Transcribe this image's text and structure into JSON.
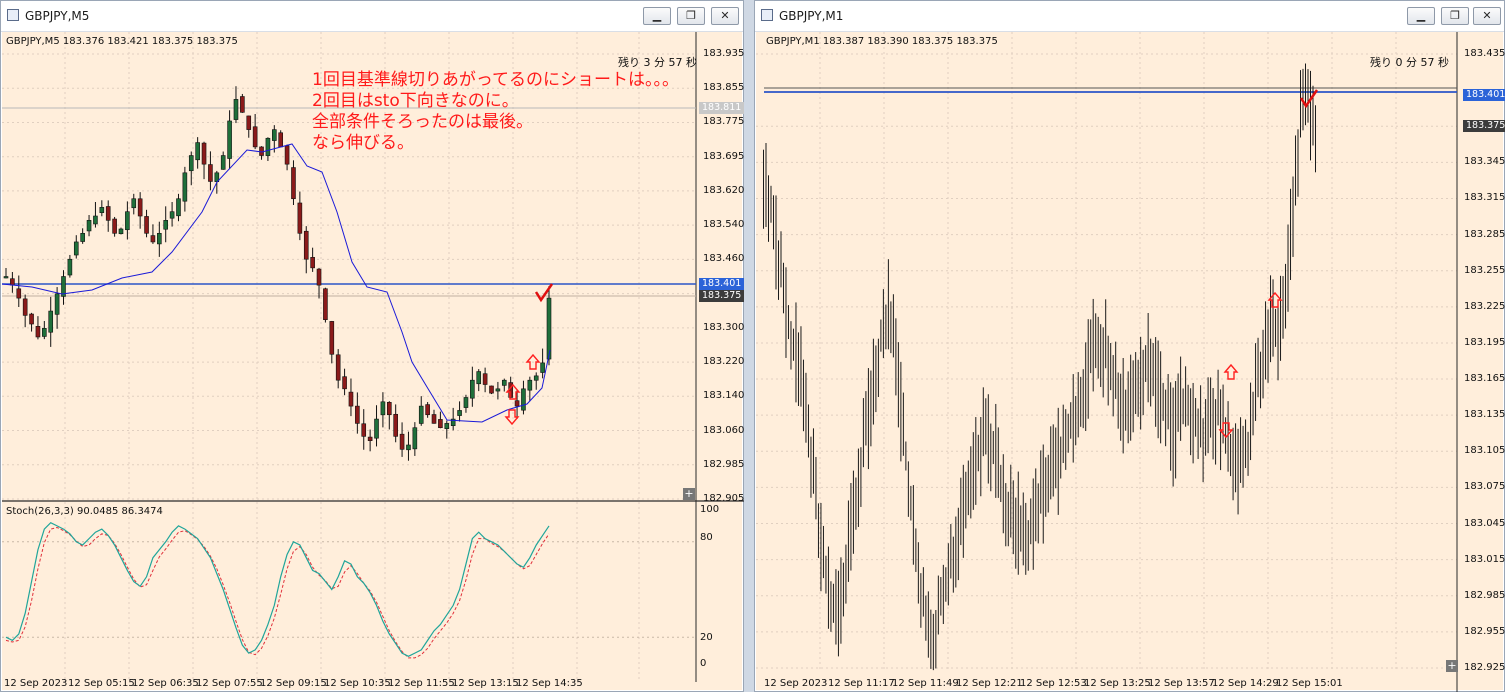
{
  "left_window": {
    "title": "GBPJPY,M5",
    "chart_header": "GBPJPY,M5  183.376 183.421 183.375 183.375",
    "remaining": "残り 3 分 57 秒",
    "y_ticks": [
      "183.935",
      "183.855",
      "183.775",
      "183.695",
      "183.620",
      "183.540",
      "183.460",
      "183.380",
      "183.300",
      "183.220",
      "183.140",
      "183.060",
      "182.985",
      "182.905"
    ],
    "price_tags": [
      {
        "label": "183.811",
        "bg": "#c8c8c8",
        "fg": "#ffffff"
      },
      {
        "label": "183.401",
        "bg": "#2b63d8",
        "fg": "#ffffff"
      },
      {
        "label": "183.375",
        "bg": "#3c3c3c",
        "fg": "#ffffff"
      }
    ],
    "annotation": [
      "1回目基準線切りあがってるのにショートは。。。",
      "2回目はsto下向きなのに。",
      "全部条件そろったのは最後。",
      "なら伸びる。"
    ],
    "stoch_header": "Stoch(26,3,3) 90.0485 86.3474",
    "stoch_ticks": [
      "100",
      "80",
      "20",
      "0"
    ],
    "x_labels": [
      "12 Sep 2023",
      "12 Sep 05:15",
      "12 Sep 06:35",
      "12 Sep 07:55",
      "12 Sep 09:15",
      "12 Sep 10:35",
      "12 Sep 11:55",
      "12 Sep 13:15",
      "12 Sep 14:35"
    ],
    "colors": {
      "bg": "#ffeedb",
      "bull": "#1f6f3a",
      "bear": "#8b1a1a",
      "baseline": "#1a1ad8",
      "hline": "#2b55c8",
      "stoch_main": "#20a59a",
      "stoch_signal": "#e0303a",
      "arrow": "#ff2020"
    }
  },
  "right_window": {
    "title": "GBPJPY,M1",
    "chart_header": "GBPJPY,M1  183.387 183.390 183.375 183.375",
    "remaining": "残り 0 分 57 秒",
    "y_ticks": [
      "183.435",
      "183.401",
      "183.375",
      "183.345",
      "183.315",
      "183.285",
      "183.255",
      "183.225",
      "183.195",
      "183.165",
      "183.135",
      "183.105",
      "183.075",
      "183.045",
      "183.015",
      "182.985",
      "182.955",
      "182.925"
    ],
    "price_tags": [
      {
        "label": "183.401",
        "bg": "#2b63d8",
        "fg": "#ffffff"
      },
      {
        "label": "183.375",
        "bg": "#3c3c3c",
        "fg": "#ffffff"
      }
    ],
    "x_labels": [
      "12 Sep 2023",
      "12 Sep 11:17",
      "12 Sep 11:49",
      "12 Sep 12:21",
      "12 Sep 12:53",
      "12 Sep 13:25",
      "12 Sep 13:57",
      "12 Sep 14:29",
      "12 Sep 15:01"
    ]
  },
  "icons": [
    "chart-window-icon",
    "minimize-icon",
    "restore-icon",
    "close-icon",
    "checkmark-icon",
    "up-arrow-icon",
    "down-arrow-icon",
    "plus-icon"
  ]
}
